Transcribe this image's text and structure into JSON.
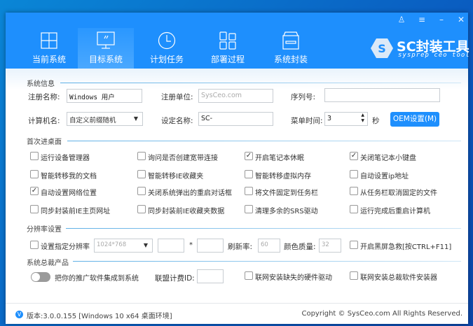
{
  "window_controls": {
    "user": "user-icon",
    "menu": "menu-icon",
    "minimize": "minimize-icon",
    "close": "close-icon"
  },
  "tabs": [
    {
      "label": "当前系统",
      "icon": "windows-icon"
    },
    {
      "label": "目标系统",
      "icon": "monitor-icon",
      "active": true
    },
    {
      "label": "计划任务",
      "icon": "clock-icon"
    },
    {
      "label": "部署过程",
      "icon": "grid-icon"
    },
    {
      "label": "系统封装",
      "icon": "box-icon"
    }
  ],
  "logo": {
    "title": "SC封装工具",
    "subtitle": "sysprep ceo tool"
  },
  "sysinfo": {
    "title": "系统信息",
    "reg_name_label": "注册名称:",
    "reg_name_value": "Windows 用户",
    "reg_org_label": "注册单位:",
    "reg_org_placeholder": "SysCeo.com",
    "serial_label": "序列号:",
    "serial_value": "",
    "computer_label": "计算机名:",
    "computer_value": "自定义前缀随机",
    "set_name_label": "设定名称:",
    "set_name_value": "SC-",
    "menu_time_label": "菜单时间:",
    "menu_time_value": "3",
    "seconds": "秒",
    "oem_button": "OEM设置(M)"
  },
  "desktop": {
    "title": "首次进桌面",
    "options": [
      {
        "label": "运行设备管理器",
        "checked": false
      },
      {
        "label": "询问是否创建宽带连接",
        "checked": false
      },
      {
        "label": "开启笔记本休眠",
        "checked": true
      },
      {
        "label": "关闭笔记本小键盘",
        "checked": true
      },
      {
        "label": "智能转移我的文档",
        "checked": false
      },
      {
        "label": "智能转移IE收藏夹",
        "checked": false
      },
      {
        "label": "智能转移虚拟内存",
        "checked": false
      },
      {
        "label": "自动设置ip地址",
        "checked": false
      },
      {
        "label": "自动设置网络位置",
        "checked": true
      },
      {
        "label": "关闭系统弹出的重启对话框",
        "checked": false
      },
      {
        "label": "将文件固定到任务栏",
        "checked": false
      },
      {
        "label": "从任务栏取消固定的文件",
        "checked": false
      },
      {
        "label": "同步封装前IE主页网址",
        "checked": false
      },
      {
        "label": "同步封装前IE收藏夹数据",
        "checked": false
      },
      {
        "label": "清理多余的SRS驱动",
        "checked": false
      },
      {
        "label": "运行完成后重启计算机",
        "checked": false
      }
    ]
  },
  "resolution": {
    "title": "分辨率设置",
    "set_label": "设置指定分辨率",
    "set_checked": false,
    "preset": "1024*768",
    "width": "",
    "times": "*",
    "height": "",
    "refresh_label": "刷新率:",
    "refresh_value": "60",
    "color_label": "颜色质量:",
    "color_value": "32",
    "rescue_label": "开启黑屏急救[按CTRL+F11]",
    "rescue_checked": false
  },
  "products": {
    "title": "系统总裁产品",
    "toggle_label": "把你的推广软件集成到系统",
    "toggle_on": false,
    "alliance_label": "联盟计费ID:",
    "alliance_value": "",
    "hw_driver_label": "联网安装缺失的硬件驱动",
    "hw_driver_checked": false,
    "installer_label": "联网安装总裁软件安装器",
    "installer_checked": false
  },
  "footer": {
    "version": "版本:3.0.0.155 [Windows 10 x64 桌面环境]",
    "copyright": "Copyright © SysCeo.com All Rights Reserved."
  },
  "colors": {
    "accent": "#1e8ffd",
    "toggle_off": "#9a9a9a"
  }
}
